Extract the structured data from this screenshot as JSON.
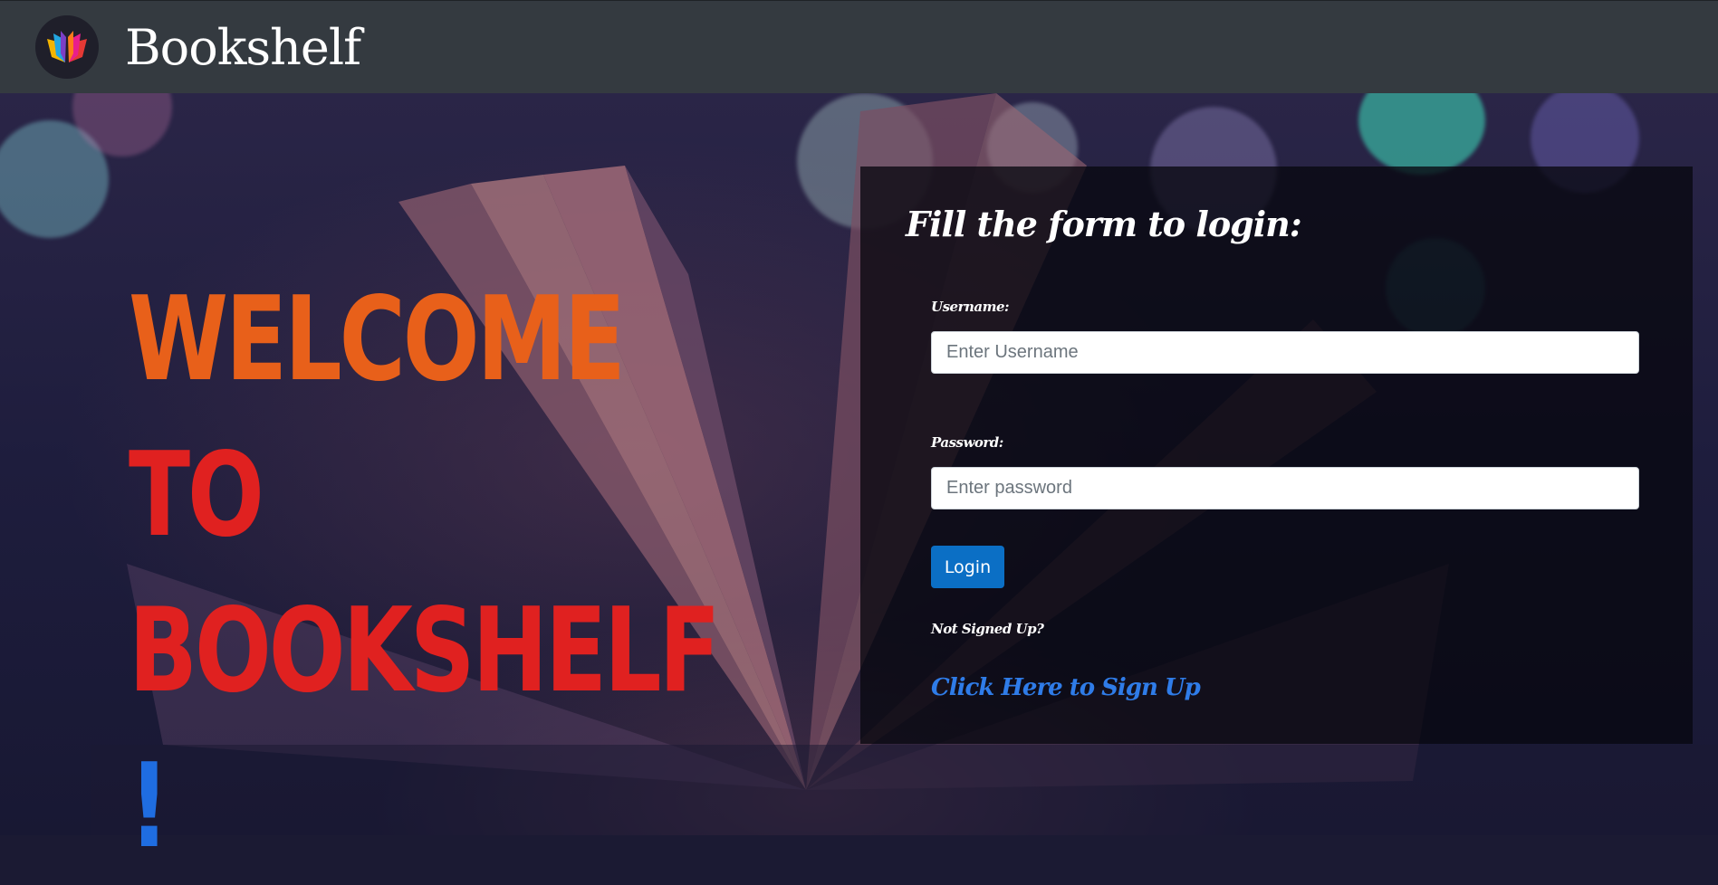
{
  "navbar": {
    "brand": "Bookshelf",
    "logo_icon": "open-book-logo-icon"
  },
  "hero": {
    "welcome_line1_part1": "WELCOME",
    "welcome_line1_part2": "TO",
    "welcome_line2": "BOOKSHELF",
    "welcome_exclaim": "!"
  },
  "login_form": {
    "title": "Fill the form to login:",
    "username_label": "Username:",
    "username_placeholder": "Enter Username",
    "username_value": "",
    "password_label": "Password:",
    "password_placeholder": "Enter password",
    "password_value": "",
    "login_button": "Login",
    "not_signed_up": "Not Signed Up?",
    "signup_link": "Click Here to Sign Up"
  },
  "colors": {
    "navbar_bg": "#343a40",
    "welcome_orange": "#e8601a",
    "welcome_red": "#e02120",
    "exclaim_blue": "#1f6de1",
    "button_blue": "#0b6fc5",
    "link_blue": "#2f7ce8"
  }
}
